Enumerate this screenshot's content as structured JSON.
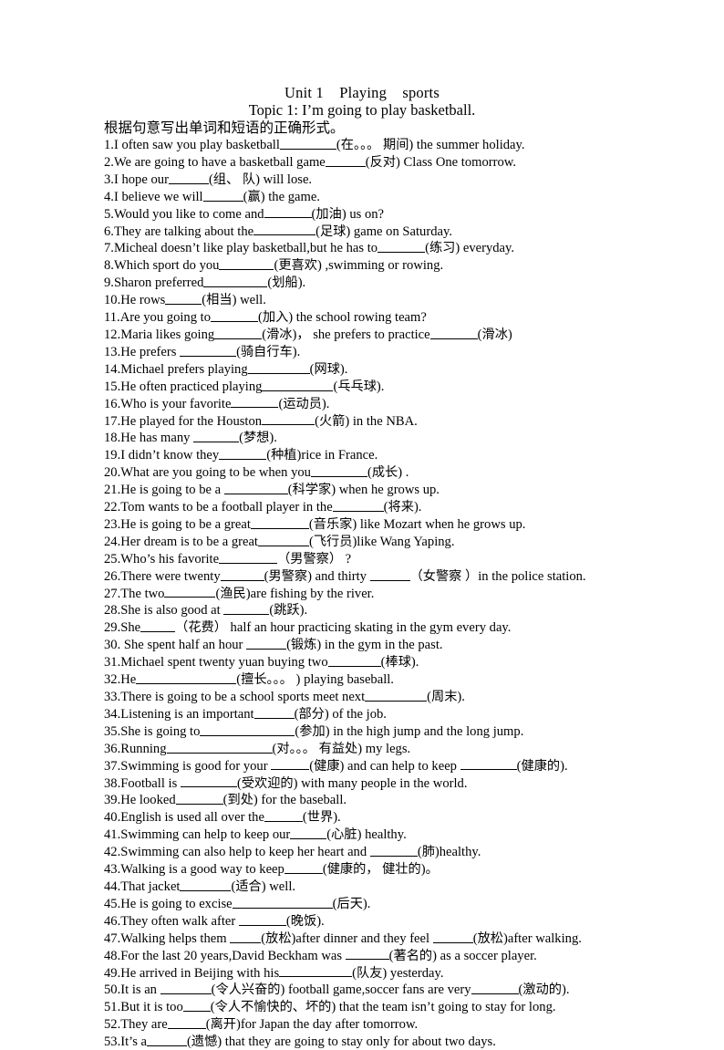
{
  "document": {
    "title_line_1": "Unit 1    Playing    sports",
    "title_line_2": "Topic 1: I’m going to play basketball.",
    "instruction": "根据句意写出单词和短语的正确形式。"
  },
  "items": [
    {
      "n": "1.",
      "segs": [
        {
          "t": "I often saw you play basketball"
        },
        {
          "blank": 62
        },
        {
          "t": "(在。。。 期间) the summer holiday."
        }
      ]
    },
    {
      "n": "2.",
      "segs": [
        {
          "t": "We are going to have a basketball game"
        },
        {
          "blank": 44
        },
        {
          "t": "(反对) Class One tomorrow."
        }
      ]
    },
    {
      "n": "3.",
      "segs": [
        {
          "t": "I hope our"
        },
        {
          "blank": 44
        },
        {
          "t": "(组、 队) will lose."
        }
      ]
    },
    {
      "n": "4.",
      "segs": [
        {
          "t": "I believe we will"
        },
        {
          "blank": 44
        },
        {
          "t": "(赢) the game."
        }
      ]
    },
    {
      "n": "5.",
      "segs": [
        {
          "t": "Would you like to come and"
        },
        {
          "blank": 52
        },
        {
          "t": "(加油) us on?"
        }
      ]
    },
    {
      "n": "6.",
      "segs": [
        {
          "t": "They are talking about the"
        },
        {
          "blank": 68
        },
        {
          "t": "(足球) game on Saturday."
        }
      ]
    },
    {
      "n": "7.",
      "segs": [
        {
          "t": "Micheal doesn’t like play basketball,but he has to"
        },
        {
          "blank": 52
        },
        {
          "t": "(练习) everyday."
        }
      ]
    },
    {
      "n": "8.",
      "segs": [
        {
          "t": "Which sport do you"
        },
        {
          "blank": 60
        },
        {
          "t": "(更喜欢) ,swimming or rowing."
        }
      ]
    },
    {
      "n": "9.",
      "segs": [
        {
          "t": "Sharon preferred"
        },
        {
          "blank": 70
        },
        {
          "t": "(划船)."
        }
      ]
    },
    {
      "n": "10.",
      "segs": [
        {
          "t": "He rows"
        },
        {
          "blank": 40
        },
        {
          "t": "(相当) well."
        }
      ]
    },
    {
      "n": "11.",
      "segs": [
        {
          "t": "Are you going to"
        },
        {
          "blank": 52
        },
        {
          "t": "(加入) the school rowing team?"
        }
      ]
    },
    {
      "n": "12.",
      "segs": [
        {
          "t": "Maria likes going"
        },
        {
          "blank": 52
        },
        {
          "t": "(滑冰)， she prefers to practice"
        },
        {
          "blank": 52
        },
        {
          "t": "(滑冰)"
        }
      ]
    },
    {
      "n": "13.",
      "segs": [
        {
          "t": "He prefers "
        },
        {
          "blank": 62
        },
        {
          "t": "(骑自行车)."
        }
      ]
    },
    {
      "n": "14.",
      "segs": [
        {
          "t": "Michael prefers playing"
        },
        {
          "blank": 68
        },
        {
          "t": "(网球)."
        }
      ]
    },
    {
      "n": "15.",
      "segs": [
        {
          "t": "He often practiced playing"
        },
        {
          "blank": 78
        },
        {
          "t": "(乓乓球)."
        }
      ]
    },
    {
      "n": "16.",
      "segs": [
        {
          "t": "Who is your favorite"
        },
        {
          "blank": 52
        },
        {
          "t": "(运动员)."
        }
      ]
    },
    {
      "n": "17.",
      "segs": [
        {
          "t": "He played for the Houston"
        },
        {
          "blank": 58
        },
        {
          "t": "(火箭) in the NBA."
        }
      ]
    },
    {
      "n": "18.",
      "segs": [
        {
          "t": "He has many "
        },
        {
          "blank": 50
        },
        {
          "t": "(梦想)."
        }
      ]
    },
    {
      "n": "19.",
      "segs": [
        {
          "t": "I didn’t know they"
        },
        {
          "blank": 52
        },
        {
          "t": "(种植)rice in France."
        }
      ]
    },
    {
      "n": "20.",
      "segs": [
        {
          "t": "What are you going to be when you"
        },
        {
          "blank": 62
        },
        {
          "t": "(成长) ."
        }
      ]
    },
    {
      "n": "21.",
      "segs": [
        {
          "t": "He is going to be a "
        },
        {
          "blank": 70
        },
        {
          "t": "(科学家) when he grows up."
        }
      ]
    },
    {
      "n": "22.",
      "segs": [
        {
          "t": "Tom wants to be a football player in the"
        },
        {
          "blank": 56
        },
        {
          "t": "(将来)."
        }
      ]
    },
    {
      "n": "23.",
      "segs": [
        {
          "t": "He is going to be a great"
        },
        {
          "blank": 64
        },
        {
          "t": "(音乐家) like Mozart when he grows up."
        }
      ]
    },
    {
      "n": "24.",
      "segs": [
        {
          "t": "Her dream is to be a great"
        },
        {
          "blank": 56
        },
        {
          "t": "(飞行员)like Wang Yaping."
        }
      ]
    },
    {
      "n": "25.",
      "segs": [
        {
          "t": "Who’s his favorite"
        },
        {
          "blank": 64
        },
        {
          "t": "（男警察） ?"
        }
      ]
    },
    {
      "n": "26.",
      "segs": [
        {
          "t": "There were twenty"
        },
        {
          "blank": 48
        },
        {
          "t": "(男警察) and thirty "
        },
        {
          "blank": 44
        },
        {
          "t": "（女警察 ）in the police station."
        }
      ]
    },
    {
      "n": "27.",
      "segs": [
        {
          "t": "The two"
        },
        {
          "blank": 56
        },
        {
          "t": "(渔民)are fishing by the river."
        }
      ]
    },
    {
      "n": "28.",
      "segs": [
        {
          "t": "She is also good at "
        },
        {
          "blank": 50
        },
        {
          "t": "(跳跃)."
        }
      ]
    },
    {
      "n": "29.",
      "segs": [
        {
          "t": "She"
        },
        {
          "blank": 38
        },
        {
          "t": "（花费） half an hour practicing skating in the gym every day."
        }
      ]
    },
    {
      "n": "30.",
      "segs": [
        {
          "t": " She spent half an hour "
        },
        {
          "blank": 44
        },
        {
          "t": "(锻炼) in the gym in the past."
        }
      ]
    },
    {
      "n": "31.",
      "segs": [
        {
          "t": "Michael spent twenty yuan buying two"
        },
        {
          "blank": 58
        },
        {
          "t": "(棒球)."
        }
      ]
    },
    {
      "n": "32.",
      "segs": [
        {
          "t": "He"
        },
        {
          "blank": 110
        },
        {
          "t": "(擅长。。。 ) playing baseball."
        }
      ]
    },
    {
      "n": "33.",
      "segs": [
        {
          "t": "There is going to be a school sports meet next"
        },
        {
          "blank": 68
        },
        {
          "t": "(周末)."
        }
      ]
    },
    {
      "n": "34.",
      "segs": [
        {
          "t": "Listening is an important"
        },
        {
          "blank": 44
        },
        {
          "t": "(部分) of the job."
        }
      ]
    },
    {
      "n": "35.",
      "segs": [
        {
          "t": "She is going to"
        },
        {
          "blank": 104
        },
        {
          "t": "(参加) in the high jump and the long jump."
        }
      ]
    },
    {
      "n": "36.",
      "segs": [
        {
          "t": "Running"
        },
        {
          "blank": 116
        },
        {
          "t": "(对。。。 有益处) my legs."
        }
      ]
    },
    {
      "n": "37.",
      "segs": [
        {
          "t": "Swimming is good for your "
        },
        {
          "blank": 42
        },
        {
          "t": "(健康) and can help to keep "
        },
        {
          "blank": 62
        },
        {
          "t": "(健康的)."
        }
      ]
    },
    {
      "n": "38.",
      "segs": [
        {
          "t": "Football is "
        },
        {
          "blank": 62
        },
        {
          "t": "(受欢迎的) with many people in the world."
        }
      ]
    },
    {
      "n": "39.",
      "segs": [
        {
          "t": "He looked"
        },
        {
          "blank": 52
        },
        {
          "t": "(到处) for the baseball."
        }
      ]
    },
    {
      "n": "40.",
      "segs": [
        {
          "t": "English is used all over the"
        },
        {
          "blank": 42
        },
        {
          "t": "(世界)."
        }
      ]
    },
    {
      "n": "41.",
      "segs": [
        {
          "t": "Swimming can help to keep our"
        },
        {
          "blank": 40
        },
        {
          "t": "(心脏) healthy."
        }
      ]
    },
    {
      "n": "42.",
      "segs": [
        {
          "t": "Swimming can also help to keep her heart and "
        },
        {
          "blank": 52
        },
        {
          "t": "(肺)healthy."
        }
      ]
    },
    {
      "n": "43.",
      "segs": [
        {
          "t": "Walking is a good way to keep"
        },
        {
          "blank": 42
        },
        {
          "t": "(健康的， 健壮的)。"
        }
      ]
    },
    {
      "n": "44.",
      "segs": [
        {
          "t": "That jacket"
        },
        {
          "blank": 56
        },
        {
          "t": "(适合) well."
        }
      ]
    },
    {
      "n": "45.",
      "segs": [
        {
          "t": "He is going to excise"
        },
        {
          "blank": 110
        },
        {
          "t": "(后天)."
        }
      ]
    },
    {
      "n": "46.",
      "segs": [
        {
          "t": "They often walk after "
        },
        {
          "blank": 52
        },
        {
          "t": "(晚饭)."
        }
      ]
    },
    {
      "n": "47.",
      "segs": [
        {
          "t": "Walking helps them "
        },
        {
          "blank": 34
        },
        {
          "t": "(放松)after dinner and they feel "
        },
        {
          "blank": 44
        },
        {
          "t": "(放松)after walking."
        }
      ]
    },
    {
      "n": "48.",
      "segs": [
        {
          "t": "For the last 20 years,David Beckham was "
        },
        {
          "blank": 48
        },
        {
          "t": "(著名的) as a soccer player."
        }
      ]
    },
    {
      "n": "49.",
      "segs": [
        {
          "t": "He arrived in Beijing with his"
        },
        {
          "blank": 80
        },
        {
          "t": "(队友) yesterday."
        }
      ]
    },
    {
      "n": "50.",
      "segs": [
        {
          "t": "It is an "
        },
        {
          "blank": 56
        },
        {
          "t": "(令人兴奋的) football game,soccer fans are very"
        },
        {
          "blank": 52
        },
        {
          "t": "(激动的)."
        }
      ]
    },
    {
      "n": "51.",
      "segs": [
        {
          "t": "But it is too"
        },
        {
          "blank": 30
        },
        {
          "t": "(令人不愉快的、坏的) that the team isn’t going to stay for long."
        }
      ]
    },
    {
      "n": "52.",
      "segs": [
        {
          "t": "They are"
        },
        {
          "blank": 42
        },
        {
          "t": "(离开)for Japan the day after tomorrow."
        }
      ]
    },
    {
      "n": "53.",
      "segs": [
        {
          "t": "It’s a"
        },
        {
          "blank": 44
        },
        {
          "t": "(遗憾) that they are going to stay only for about two days."
        }
      ]
    }
  ]
}
